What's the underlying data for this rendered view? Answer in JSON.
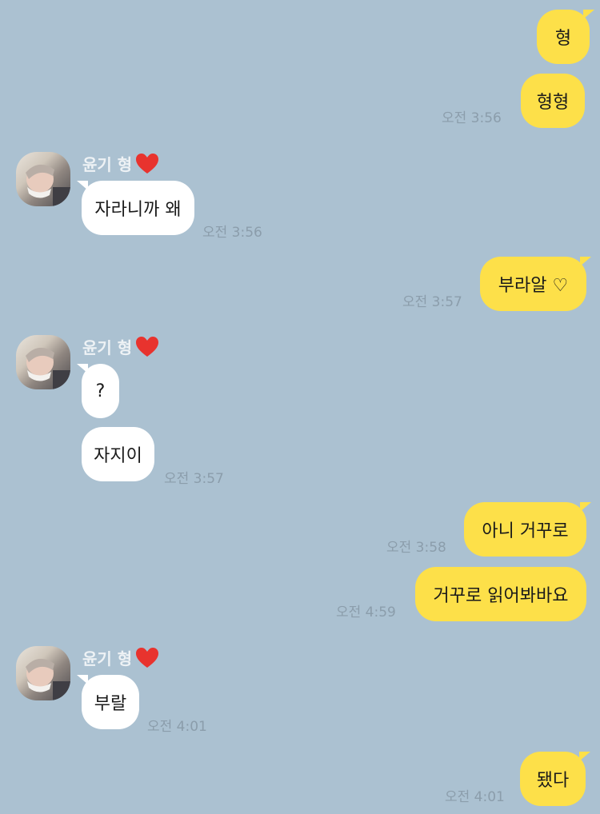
{
  "contact": {
    "name": "윤기 형"
  },
  "messages": [
    {
      "text": "형",
      "time": ""
    },
    {
      "text": "형형",
      "time": "오전 3:56"
    },
    {
      "text": "자라니까 왜",
      "time": "오전 3:56"
    },
    {
      "text": "부라알 ♡",
      "time": "오전 3:57"
    },
    {
      "text": "?",
      "time": ""
    },
    {
      "text": "자지이",
      "time": "오전 3:57"
    },
    {
      "text": "아니 거꾸로",
      "time": "오전 3:58"
    },
    {
      "text": "거꾸로 읽어봐바요",
      "time": "오전 4:59"
    },
    {
      "text": "부랄",
      "time": "오전 4:01"
    },
    {
      "text": "됐다",
      "time": "오전 4:01"
    }
  ],
  "colors": {
    "background": "#abc1d1",
    "my_bubble": "#fde049",
    "their_bubble": "#ffffff"
  }
}
